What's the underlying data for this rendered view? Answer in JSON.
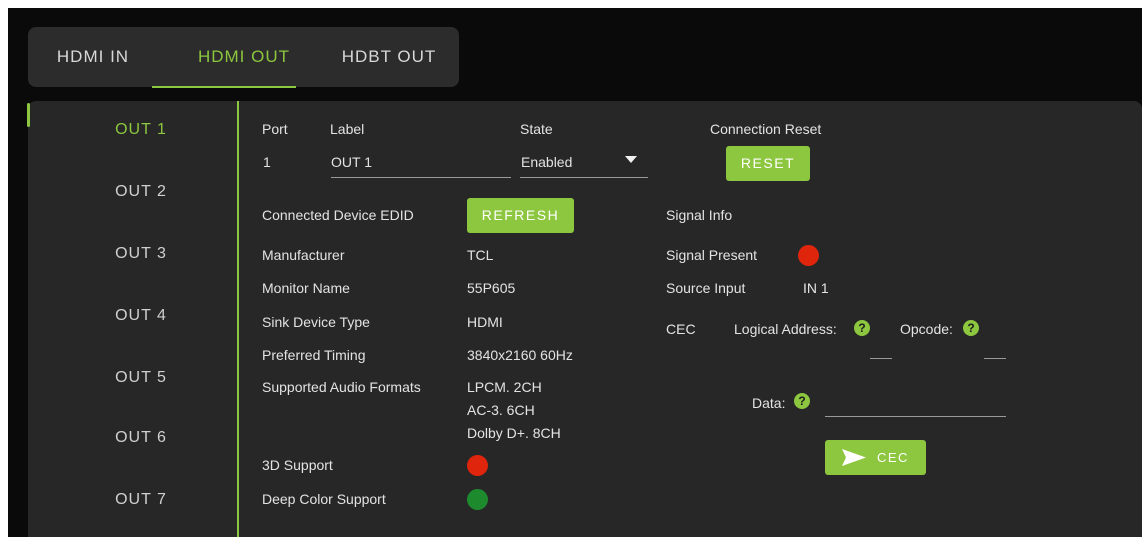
{
  "tabs": [
    {
      "label": "HDMI IN",
      "active": false
    },
    {
      "label": "HDMI OUT",
      "active": true
    },
    {
      "label": "HDBT OUT",
      "active": false
    }
  ],
  "sidebar": {
    "items": [
      {
        "label": "OUT 1",
        "active": true
      },
      {
        "label": "OUT 2",
        "active": false
      },
      {
        "label": "OUT 3",
        "active": false
      },
      {
        "label": "OUT 4",
        "active": false
      },
      {
        "label": "OUT 5",
        "active": false
      },
      {
        "label": "OUT 6",
        "active": false
      },
      {
        "label": "OUT 7",
        "active": false
      }
    ]
  },
  "port": {
    "port_header": "Port",
    "port_value": "1",
    "label_header": "Label",
    "label_value": "OUT 1",
    "state_header": "State",
    "state_value": "Enabled",
    "reset_header": "Connection Reset",
    "reset_button": "RESET"
  },
  "edid": {
    "title": "Connected Device EDID",
    "refresh_button": "REFRESH",
    "rows": [
      {
        "label": "Manufacturer",
        "value": "TCL"
      },
      {
        "label": "Monitor Name",
        "value": "55P605"
      },
      {
        "label": "Sink Device Type",
        "value": "HDMI"
      },
      {
        "label": "Preferred Timing",
        "value": "3840x2160 60Hz"
      },
      {
        "label": "Supported Audio Formats",
        "value": ""
      }
    ],
    "audio_formats": [
      "LPCM. 2CH",
      "AC-3. 6CH",
      "Dolby D+. 8CH"
    ],
    "support_3d_label": "3D Support",
    "support_3d_status": "off",
    "deep_color_label": "Deep Color Support",
    "deep_color_status": "on"
  },
  "signal": {
    "title": "Signal Info",
    "present_label": "Signal Present",
    "present_status": "off",
    "source_label": "Source Input",
    "source_value": "IN 1"
  },
  "cec": {
    "label": "CEC",
    "logical_address_label": "Logical Address:",
    "opcode_label": "Opcode:",
    "data_label": "Data:",
    "help_glyph": "?",
    "send_icon": "send-icon",
    "send_button": "CEC"
  },
  "colors": {
    "accent": "#8dc63f",
    "status_red": "#e0250d",
    "status_green": "#1e8a2e",
    "panel": "#272727",
    "background": "#0a0a0a"
  }
}
